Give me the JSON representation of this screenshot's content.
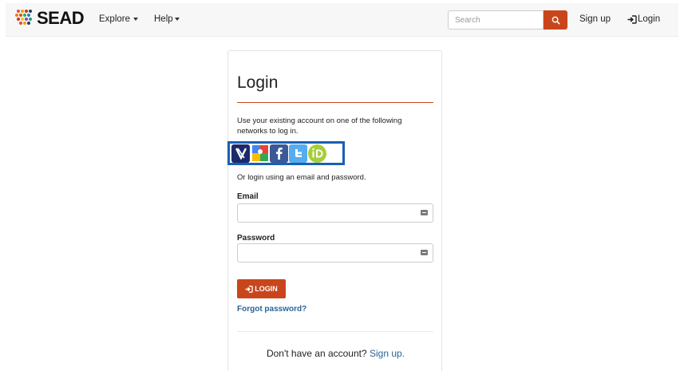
{
  "navbar": {
    "brand": "SEAD",
    "explore_label": "Explore",
    "help_label": "Help",
    "search_placeholder": "Search",
    "signup_label": "Sign up",
    "login_label": "Login"
  },
  "login_card": {
    "title": "Login",
    "intro": "Use your existing account on one of the following networks to log in.",
    "providers": [
      {
        "name": "cilogon",
        "icon": "cilogon-icon",
        "color": "#1a2a6c"
      },
      {
        "name": "google",
        "icon": "google-icon",
        "color": "#4285f4"
      },
      {
        "name": "facebook",
        "icon": "facebook-icon",
        "color": "#3b5998"
      },
      {
        "name": "twitter",
        "icon": "twitter-icon",
        "color": "#55acee"
      },
      {
        "name": "orcid",
        "icon": "orcid-icon",
        "color": "#a6ce39"
      }
    ],
    "alt_text": "Or login using an email and password.",
    "email_label": "Email",
    "email_value": "",
    "password_label": "Password",
    "password_value": "",
    "login_button": "LOGIN",
    "forgot_password": "Forgot password?",
    "no_account_text": "Don't have an account?",
    "signup_link": "Sign up."
  },
  "colors": {
    "accent": "#c9461c",
    "link": "#2a6496",
    "highlight_border": "#1a5fb4"
  }
}
